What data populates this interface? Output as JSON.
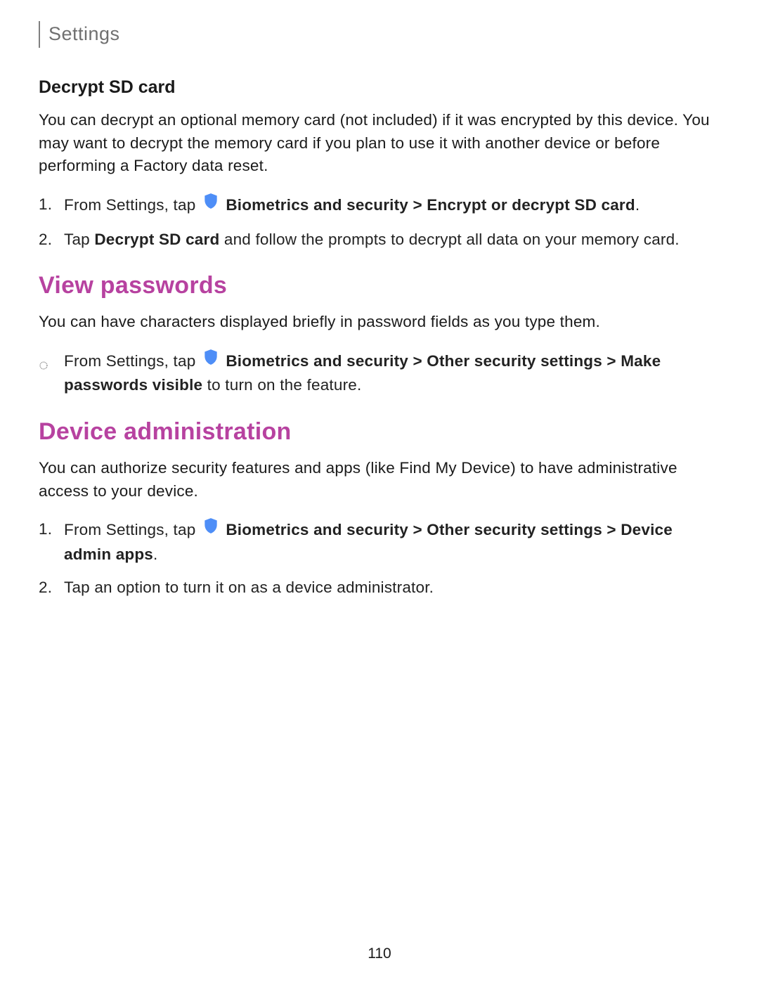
{
  "header": {
    "title": "Settings"
  },
  "sections": {
    "decrypt": {
      "heading": "Decrypt SD card",
      "body": "You can decrypt an optional memory card (not included) if it was encrypted by this device. You may want to decrypt the memory card if you plan to use it with another device or before performing a Factory data reset.",
      "step1_prefix": "From Settings, tap ",
      "step1_bold1": "Biometrics and security",
      "step1_sep": " > ",
      "step1_bold2": "Encrypt or decrypt SD card",
      "step1_end": ".",
      "step2_a": "Tap ",
      "step2_bold": "Decrypt SD card",
      "step2_b": " and follow the prompts to decrypt all data on your memory card."
    },
    "viewpw": {
      "heading": "View passwords",
      "body": "You can have characters displayed briefly in password fields as you type them.",
      "bullet_prefix": "From Settings, tap ",
      "bullet_bold1": "Biometrics and security",
      "bullet_sep": " > ",
      "bullet_bold2": "Other security settings",
      "bullet_sep2": " > ",
      "bullet_bold3": "Make passwords visible",
      "bullet_end": " to turn on the feature."
    },
    "devadmin": {
      "heading": "Device administration",
      "body": "You can authorize security features and apps (like Find My Device) to have administrative access to your device.",
      "step1_prefix": "From Settings, tap ",
      "step1_bold1": "Biometrics and security",
      "step1_sep": " > ",
      "step1_bold2": "Other security settings",
      "step1_sep2": " > ",
      "step1_bold3": "Device admin apps",
      "step1_end": ".",
      "step2": "Tap an option to turn it on as a device administrator."
    }
  },
  "pageNumber": "110",
  "colors": {
    "accent": "#b742a0",
    "shield": "#4e8ef7"
  }
}
